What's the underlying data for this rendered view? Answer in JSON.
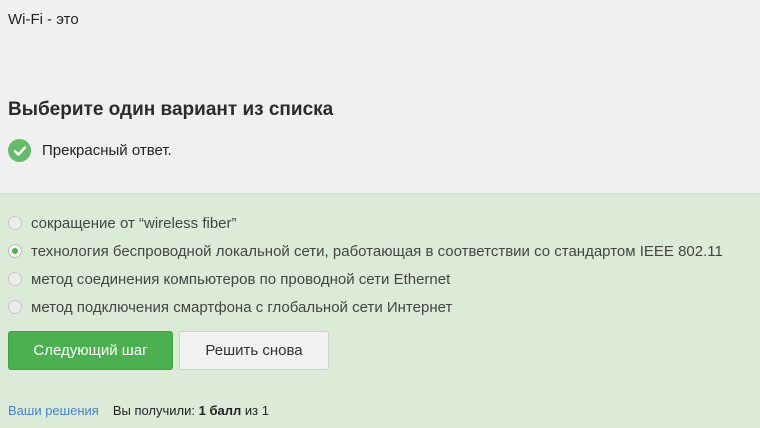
{
  "question": {
    "text": "Wi-Fi - это",
    "instruction": "Выберите один вариант из списка",
    "feedback": "Прекрасный ответ."
  },
  "options": [
    {
      "label": "сокращение от “wireless fiber”",
      "selected": false
    },
    {
      "label": "технология беспроводной локальной сети, работающая в соответствии со стандартом IEEE 802.11",
      "selected": true
    },
    {
      "label": "метод соединения компьютеров по проводной сети Ethernet",
      "selected": false
    },
    {
      "label": "метод подключения смартфона с глобальной сети Интернет",
      "selected": false
    }
  ],
  "buttons": {
    "next": "Следующий шаг",
    "retry": "Решить снова"
  },
  "footer": {
    "solutions_link": "Ваши решения",
    "score_prefix": "Вы получили:",
    "score_value": "1 балл",
    "score_suffix": "из 1"
  },
  "colors": {
    "success": "#66bb6a",
    "primary_button": "#4caf50",
    "answer_background": "#dcebd7",
    "link": "#4a7fcf"
  },
  "icons": {
    "feedback": "check-circle-icon",
    "selected_option": "radio-selected-icon"
  }
}
